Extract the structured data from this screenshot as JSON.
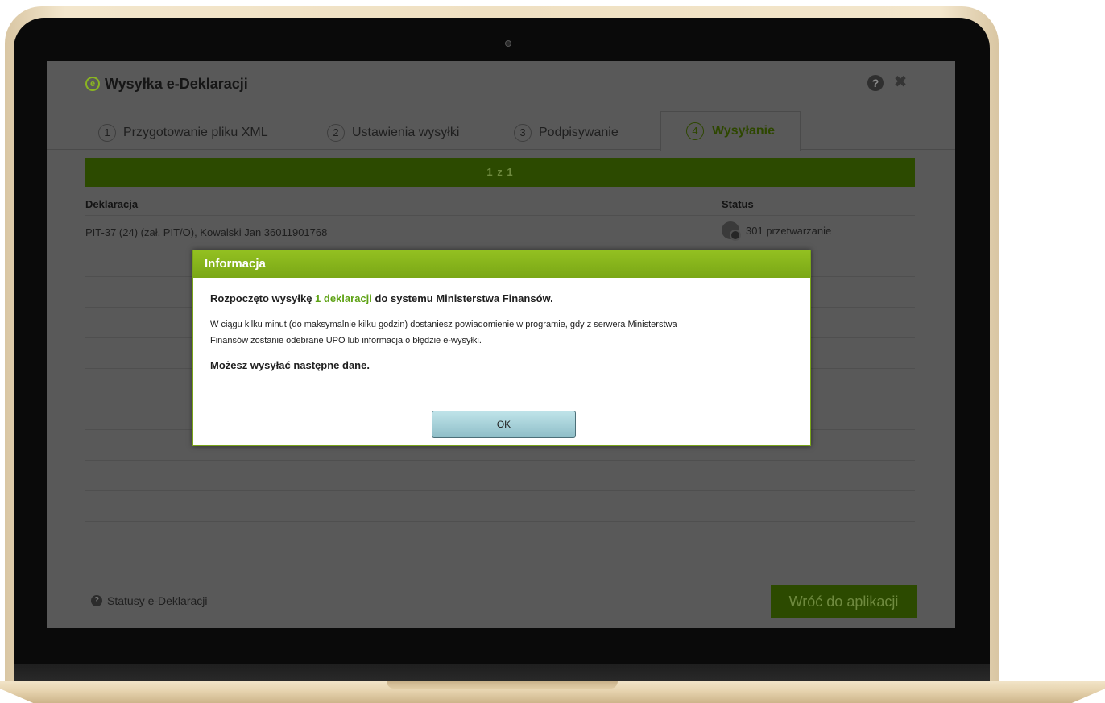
{
  "app": {
    "logo_letter": "e",
    "title": "Wysyłka e-Deklaracji",
    "help_icon": "?",
    "close_icon": "✖"
  },
  "tabs": [
    {
      "num": "1",
      "label": "Przygotowanie pliku XML"
    },
    {
      "num": "2",
      "label": "Ustawienia wysyłki"
    },
    {
      "num": "3",
      "label": "Podpisywanie"
    },
    {
      "num": "4",
      "label": "Wysyłanie"
    }
  ],
  "progress": {
    "text": "1 z 1",
    "fraction": 1.0
  },
  "table": {
    "headers": {
      "declaration": "Deklaracja",
      "status": "Status"
    },
    "rows": [
      {
        "declaration": "PIT-37 (24) (zał. PIT/O), Kowalski Jan 36011901768",
        "status": "301 przetwarzanie"
      }
    ]
  },
  "footer": {
    "help_link": "Statusy e-Deklaracji",
    "back_button": "Wróć do aplikacji"
  },
  "modal": {
    "title": "Informacja",
    "lead_before": "Rozpoczęto wysyłkę ",
    "lead_highlight": "1 deklaracji",
    "lead_after": " do systemu Ministerstwa Finansów.",
    "text_line1": "W ciągu kilku minut (do maksymalnie kilku godzin) dostaniesz powiadomienie w programie, gdy z serwera Ministerstwa",
    "text_line2": "Finansów zostanie odebrane UPO lub informacja o błędzie e-wysyłki.",
    "note": "Możesz wysyłać następne dane.",
    "ok_button": "OK"
  },
  "colors": {
    "accent": "#7aa716",
    "dimmed_accent": "#2c4a00",
    "highlight": "#5ea215"
  }
}
